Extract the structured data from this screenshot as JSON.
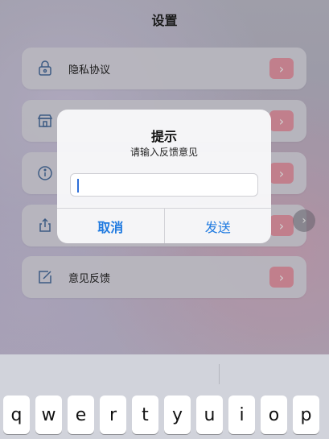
{
  "page": {
    "title": "设置"
  },
  "menu": {
    "items": [
      {
        "label": "隐私协议",
        "icon": "lock-icon"
      },
      {
        "label": "",
        "icon": "shop-icon"
      },
      {
        "label": "",
        "icon": "info-icon"
      },
      {
        "label": "",
        "icon": "share-icon"
      },
      {
        "label": "意见反馈",
        "icon": "edit-icon"
      }
    ],
    "arrow_glyph": "›",
    "arrow_color": "#ec9cab"
  },
  "scroll_button": {
    "glyph": "›"
  },
  "alert": {
    "title": "提示",
    "message": "请输入反馈意见",
    "input_value": "",
    "cancel_label": "取消",
    "send_label": "发送",
    "button_color": "#1f7ae0"
  },
  "keyboard": {
    "row1": [
      "q",
      "w",
      "e",
      "r",
      "t",
      "y",
      "u",
      "i",
      "o",
      "p"
    ]
  }
}
